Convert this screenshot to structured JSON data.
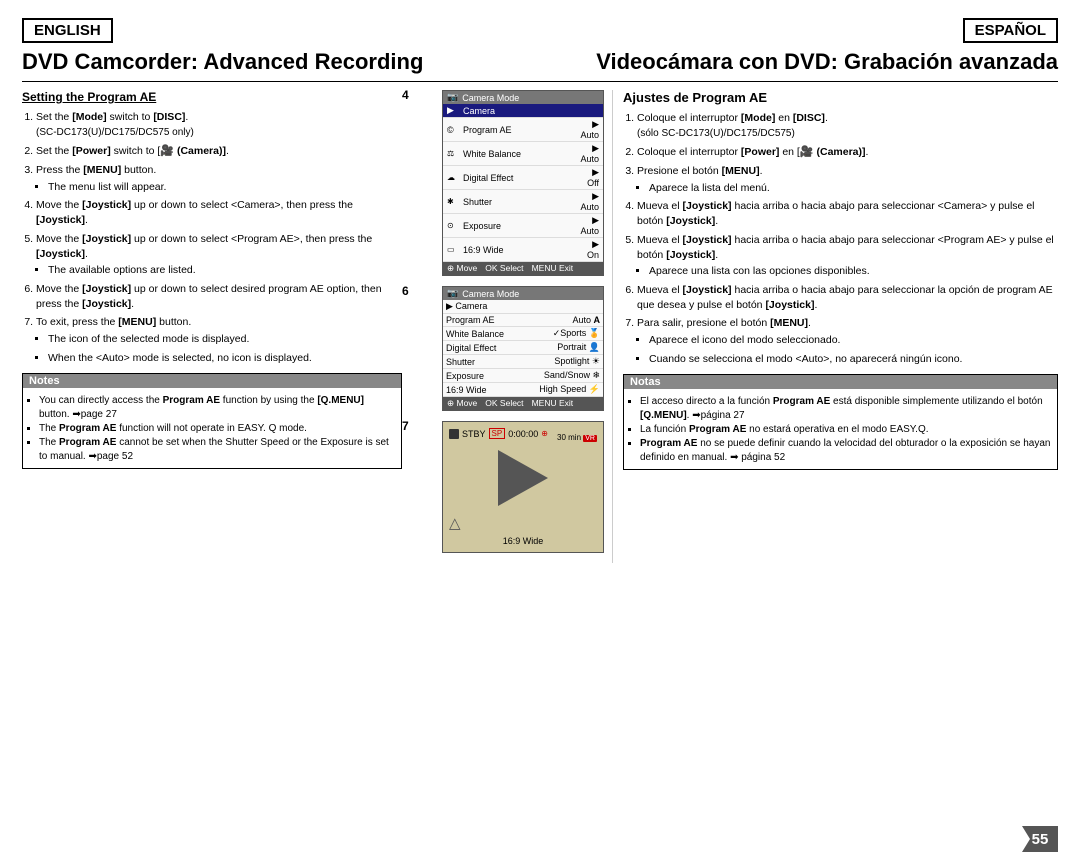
{
  "header": {
    "lang_en": "ENGLISH",
    "lang_es": "ESPAÑOL"
  },
  "titles": {
    "en": "DVD Camcorder: Advanced Recording",
    "es": "Videocámara con DVD: Grabación avanzada"
  },
  "english": {
    "section_title": "Setting the Program AE",
    "steps": [
      {
        "text": "Set the [Mode] switch to [DISC].",
        "sub": "(SC-DC173(U)/DC175/DC575 only)"
      },
      {
        "text": "Set the [Power] switch to [ (Camera)]."
      },
      {
        "text": "Press the [MENU] button.",
        "bullets": [
          "The menu list will appear."
        ]
      },
      {
        "text": "Move the [Joystick] up or down to select <Camera>, then press the [Joystick]."
      },
      {
        "text": "Move the [Joystick] up or down to select <Program AE>, then press the [Joystick].",
        "bullets": [
          "The available options are listed."
        ]
      },
      {
        "text": "Move the [Joystick] up or down to select desired program AE option, then press the [Joystick]."
      },
      {
        "text": "To exit, press the [MENU] button.",
        "bullets": [
          "The icon of the selected mode is displayed.",
          "When the <Auto> mode is selected, no icon is displayed."
        ]
      }
    ],
    "notes_title": "Notes",
    "notes": [
      "You can directly access the Program AE function by using the [Q.MENU] button. →page 27",
      "The Program AE function will not operate in EASY. Q mode.",
      "The Program AE cannot be set when the Shutter Speed or the Exposure is set to manual. →page 52"
    ]
  },
  "diagrams": {
    "d4": {
      "step": "4",
      "header": "Camera Mode",
      "cam_label": "Camera",
      "rows": [
        {
          "icon": "©",
          "label": "Program AE",
          "value": "Auto",
          "active": false
        },
        {
          "icon": "©",
          "label": "White Balance",
          "value": "Auto",
          "active": false
        },
        {
          "icon": "☁",
          "label": "Digital Effect",
          "value": "Off",
          "active": false
        },
        {
          "icon": "✱",
          "label": "Shutter",
          "value": "Auto",
          "active": false
        },
        {
          "icon": "⚙",
          "label": "Exposure",
          "value": "Auto",
          "active": false
        },
        {
          "icon": "▭",
          "label": "16:9 Wide",
          "value": "On",
          "active": false
        }
      ],
      "footer": "Move Select MENU Exit"
    },
    "d6": {
      "step": "6",
      "header": "Camera Mode",
      "cam_label": "Camera",
      "menu_rows": [
        {
          "label": "Program AE",
          "right": "Auto",
          "tag": "A",
          "active": false
        },
        {
          "label": "White Balance",
          "right": "✓Sports",
          "tag": "",
          "active": false
        },
        {
          "label": "Digital Effect",
          "right": "Portrait",
          "tag": "",
          "active": false
        },
        {
          "label": "Shutter",
          "right": "Spotlight",
          "tag": "",
          "active": false
        },
        {
          "label": "Exposure",
          "right": "Sand/Snow",
          "tag": "",
          "active": false
        },
        {
          "label": "16:9 Wide",
          "right": "High Speed",
          "tag": "",
          "active": false
        }
      ],
      "footer": "Move Select MENU Exit"
    },
    "d7": {
      "step": "7",
      "stby": "STBY",
      "sp": "SP",
      "time": "0:00:00",
      "remain": "30 min",
      "label": "16:9 Wide"
    }
  },
  "spanish": {
    "section_title": "Ajustes de Program AE",
    "steps": [
      {
        "text": "Coloque el interruptor [Mode] en [DISC]. (sólo SC-DC173(U)/DC175/DC575)"
      },
      {
        "text": "Coloque el interruptor [Power] en [ (Camera)]."
      },
      {
        "text": "Presione el botón [MENU].",
        "bullets": [
          "Aparece la lista del menú."
        ]
      },
      {
        "text": "Mueva el [Joystick] hacia arriba o hacia abajo para seleccionar <Camera> y pulse el botón [Joystick]."
      },
      {
        "text": "Mueva el [Joystick] hacia arriba o hacia abajo para seleccionar <Program AE> y pulse el botón [Joystick].",
        "bullets": [
          "Aparece una lista con las opciones disponibles."
        ]
      },
      {
        "text": "Mueva el [Joystick] hacia arriba o hacia abajo para seleccionar la opción de program AE que desea y pulse el botón [Joystick]."
      },
      {
        "text": "Para salir, presione el botón [MENU].",
        "bullets": [
          "Aparece el icono del modo seleccionado.",
          "Cuando se selecciona el modo <Auto>, no aparecerá ningún icono."
        ]
      }
    ],
    "notes_title": "Notas",
    "notes": [
      "El acceso directo a la función Program AE está disponible simplemente utilizando el botón [Q.MENU]. →página 27",
      "La función Program AE no estará operativa en el modo EASY.Q.",
      "Program AE no se puede definir cuando la velocidad del obturador o la exposición se hayan definido en manual. → página 52"
    ]
  },
  "page_number": "55"
}
